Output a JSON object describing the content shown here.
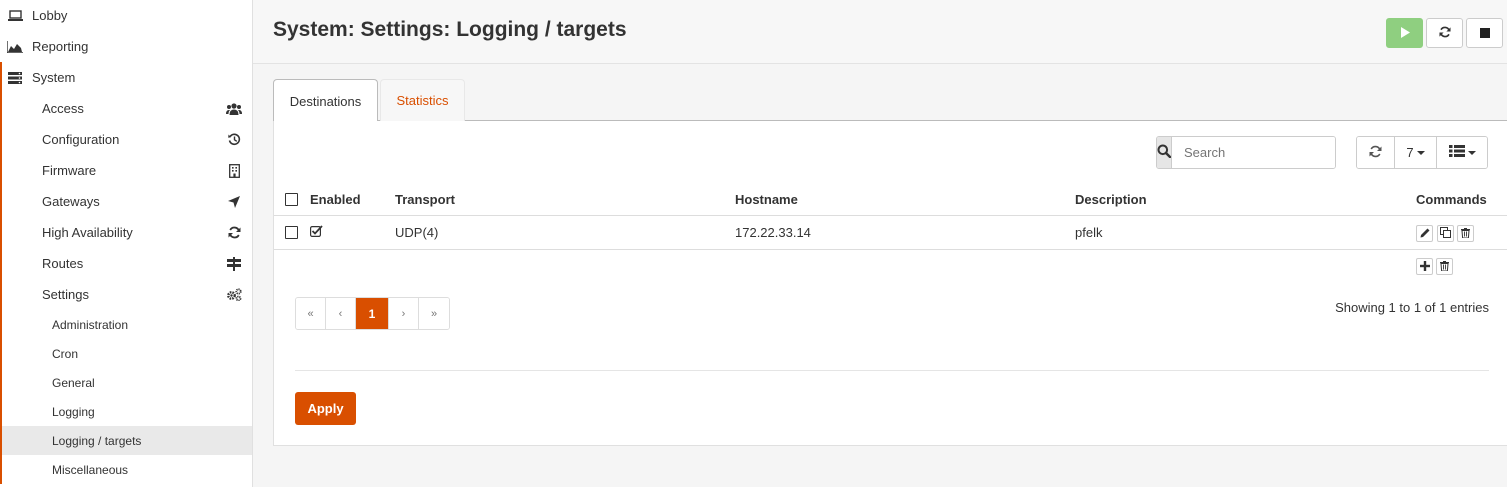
{
  "sidebar": {
    "top": [
      {
        "label": "Lobby",
        "icon": "laptop-icon"
      },
      {
        "label": "Reporting",
        "icon": "area-chart-icon"
      },
      {
        "label": "System",
        "icon": "server-icon"
      }
    ],
    "system_items": [
      {
        "label": "Access",
        "icon": "users-icon"
      },
      {
        "label": "Configuration",
        "icon": "history-icon"
      },
      {
        "label": "Firmware",
        "icon": "building-icon"
      },
      {
        "label": "Gateways",
        "icon": "location-arrow-icon"
      },
      {
        "label": "High Availability",
        "icon": "refresh-icon"
      },
      {
        "label": "Routes",
        "icon": "map-signs-icon"
      },
      {
        "label": "Settings",
        "icon": "cogs-icon"
      }
    ],
    "settings_items": [
      {
        "label": "Administration"
      },
      {
        "label": "Cron"
      },
      {
        "label": "General"
      },
      {
        "label": "Logging"
      },
      {
        "label": "Logging / targets",
        "active": true
      },
      {
        "label": "Miscellaneous"
      }
    ]
  },
  "header": {
    "title": "System: Settings: Logging / targets",
    "buttons": [
      "play-icon",
      "refresh-icon",
      "stop-icon"
    ]
  },
  "tabs": [
    {
      "label": "Destinations",
      "active": true
    },
    {
      "label": "Statistics",
      "active": false
    }
  ],
  "toolbar": {
    "search_placeholder": "Search",
    "rows_per_page": "7"
  },
  "table": {
    "columns": [
      "Enabled",
      "Transport",
      "Hostname",
      "Description",
      "Commands"
    ],
    "rows": [
      {
        "enabled": true,
        "transport": "UDP(4)",
        "hostname": "172.22.33.14",
        "description": "pfelk"
      }
    ]
  },
  "pagination": {
    "first": "«",
    "prev": "‹",
    "current": "1",
    "next": "›",
    "last": "»",
    "info": "Showing 1 to 1 of 1 entries"
  },
  "apply_label": "Apply",
  "colors": {
    "accent": "#d94f00",
    "play_button": "#8fcf80"
  }
}
